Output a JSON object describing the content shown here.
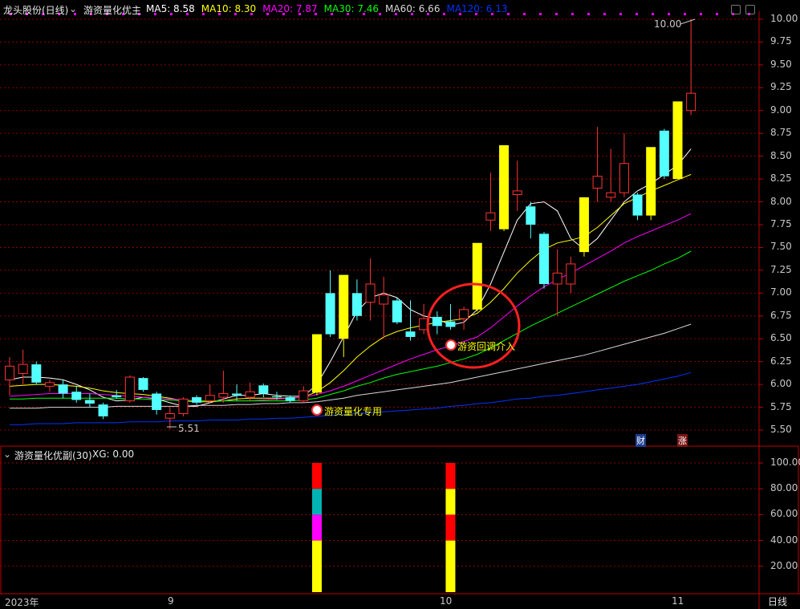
{
  "header": {
    "stock": "龙头股份(日线)",
    "indicator_main": "游资量化优主",
    "ma": [
      {
        "label": "MA5: 8.58",
        "color": "#ffffff"
      },
      {
        "label": "MA10: 8.30",
        "color": "#ffff00"
      },
      {
        "label": "MA20: 7.87",
        "color": "#ff00ff"
      },
      {
        "label": "MA30: 7.46",
        "color": "#00ff00"
      },
      {
        "label": "MA60: 6.66",
        "color": "#d8d8d8"
      },
      {
        "label": "MA120: 6.13",
        "color": "#0033ff"
      }
    ]
  },
  "sub_header": {
    "indicator": "游资量化优副(30)",
    "xg": "XG: 0.00"
  },
  "annotations": {
    "high_value": "10.00",
    "low_value": "5.51",
    "signal_1": "游资量化专用",
    "signal_2": "游资回调介入",
    "badge_cai": "财",
    "badge_zhang": "涨"
  },
  "x_axis": {
    "labels": [
      "2023年",
      "9",
      "10",
      "11"
    ],
    "period": "日线"
  },
  "colors": {
    "up": "#ff3232",
    "down": "#54ffff",
    "signal": "#ffff00",
    "grid": "#8b0000",
    "border": "#c00000"
  },
  "chart_data": [
    {
      "type": "candlestick",
      "title": "",
      "ylim": [
        5.4,
        10.1
      ],
      "y_ticks": [
        "10.00",
        "9.75",
        "9.50",
        "9.25",
        "9.00",
        "8.75",
        "8.50",
        "8.25",
        "8.00",
        "7.75",
        "7.50",
        "7.25",
        "7.00",
        "6.75",
        "6.50",
        "6.25",
        "6.00",
        "5.75",
        "5.50"
      ],
      "candles": [
        {
          "o": 6.05,
          "h": 6.3,
          "l": 5.88,
          "c": 6.2,
          "s": "up"
        },
        {
          "o": 6.12,
          "h": 6.38,
          "l": 6.0,
          "c": 6.22,
          "s": "up"
        },
        {
          "o": 6.22,
          "h": 6.25,
          "l": 6.0,
          "c": 6.02,
          "s": "down"
        },
        {
          "o": 5.98,
          "h": 6.05,
          "l": 5.92,
          "c": 6.02,
          "s": "up"
        },
        {
          "o": 6.0,
          "h": 6.05,
          "l": 5.85,
          "c": 5.9,
          "s": "down"
        },
        {
          "o": 5.92,
          "h": 5.98,
          "l": 5.8,
          "c": 5.83,
          "s": "down"
        },
        {
          "o": 5.83,
          "h": 5.9,
          "l": 5.75,
          "c": 5.79,
          "s": "down"
        },
        {
          "o": 5.78,
          "h": 5.8,
          "l": 5.62,
          "c": 5.65,
          "s": "down"
        },
        {
          "o": 5.88,
          "h": 5.94,
          "l": 5.84,
          "c": 5.86,
          "s": "down"
        },
        {
          "o": 5.82,
          "h": 6.1,
          "l": 5.8,
          "c": 6.08,
          "s": "up"
        },
        {
          "o": 6.07,
          "h": 6.08,
          "l": 5.92,
          "c": 5.94,
          "s": "down"
        },
        {
          "o": 5.9,
          "h": 5.92,
          "l": 5.67,
          "c": 5.72,
          "s": "down"
        },
        {
          "o": 5.63,
          "h": 5.75,
          "l": 5.51,
          "c": 5.68,
          "s": "up"
        },
        {
          "o": 5.68,
          "h": 5.86,
          "l": 5.65,
          "c": 5.84,
          "s": "up"
        },
        {
          "o": 5.86,
          "h": 5.88,
          "l": 5.78,
          "c": 5.8,
          "s": "down"
        },
        {
          "o": 5.82,
          "h": 6.0,
          "l": 5.8,
          "c": 5.88,
          "s": "up"
        },
        {
          "o": 5.86,
          "h": 6.15,
          "l": 5.8,
          "c": 5.9,
          "s": "up"
        },
        {
          "o": 5.88,
          "h": 6.0,
          "l": 5.82,
          "c": 5.9,
          "s": "down"
        },
        {
          "o": 5.86,
          "h": 6.02,
          "l": 5.82,
          "c": 5.92,
          "s": "up"
        },
        {
          "o": 5.99,
          "h": 6.01,
          "l": 5.86,
          "c": 5.9,
          "s": "down"
        },
        {
          "o": 5.86,
          "h": 5.92,
          "l": 5.83,
          "c": 5.87,
          "s": "down"
        },
        {
          "o": 5.86,
          "h": 5.88,
          "l": 5.8,
          "c": 5.82,
          "s": "down"
        },
        {
          "o": 5.82,
          "h": 5.98,
          "l": 5.8,
          "c": 5.93,
          "s": "up"
        },
        {
          "o": 5.91,
          "h": 6.55,
          "l": 5.88,
          "c": 6.55,
          "s": "signal"
        },
        {
          "o": 6.55,
          "h": 7.25,
          "l": 6.52,
          "c": 7.0,
          "s": "down"
        },
        {
          "o": 6.5,
          "h": 7.2,
          "l": 6.3,
          "c": 7.2,
          "s": "signal"
        },
        {
          "o": 7.0,
          "h": 7.15,
          "l": 6.7,
          "c": 6.75,
          "s": "down"
        },
        {
          "o": 6.9,
          "h": 7.38,
          "l": 6.7,
          "c": 7.1,
          "s": "up"
        },
        {
          "o": 6.88,
          "h": 7.18,
          "l": 6.5,
          "c": 6.98,
          "s": "up"
        },
        {
          "o": 6.92,
          "h": 6.95,
          "l": 6.66,
          "c": 6.68,
          "s": "down"
        },
        {
          "o": 6.58,
          "h": 6.92,
          "l": 6.48,
          "c": 6.52,
          "s": "down"
        },
        {
          "o": 6.6,
          "h": 6.88,
          "l": 6.55,
          "c": 6.72,
          "s": "up"
        },
        {
          "o": 6.74,
          "h": 6.8,
          "l": 6.55,
          "c": 6.64,
          "s": "down"
        },
        {
          "o": 6.63,
          "h": 6.88,
          "l": 6.6,
          "c": 6.69,
          "s": "down"
        },
        {
          "o": 6.72,
          "h": 6.85,
          "l": 6.6,
          "c": 6.82,
          "s": "up"
        },
        {
          "o": 6.82,
          "h": 7.55,
          "l": 6.8,
          "c": 7.55,
          "s": "signal"
        },
        {
          "o": 7.8,
          "h": 8.32,
          "l": 7.68,
          "c": 7.88,
          "s": "up"
        },
        {
          "o": 7.7,
          "h": 8.62,
          "l": 7.68,
          "c": 8.62,
          "s": "signal"
        },
        {
          "o": 8.08,
          "h": 8.45,
          "l": 7.9,
          "c": 8.12,
          "s": "up"
        },
        {
          "o": 7.95,
          "h": 8.0,
          "l": 7.6,
          "c": 7.75,
          "s": "down"
        },
        {
          "o": 7.65,
          "h": 7.67,
          "l": 7.05,
          "c": 7.1,
          "s": "down"
        },
        {
          "o": 7.22,
          "h": 7.48,
          "l": 6.75,
          "c": 7.1,
          "s": "up"
        },
        {
          "o": 7.1,
          "h": 7.4,
          "l": 7.0,
          "c": 7.32,
          "s": "up"
        },
        {
          "o": 7.45,
          "h": 8.05,
          "l": 7.4,
          "c": 8.05,
          "s": "signal"
        },
        {
          "o": 8.15,
          "h": 8.82,
          "l": 8.0,
          "c": 8.28,
          "s": "up"
        },
        {
          "o": 8.05,
          "h": 8.58,
          "l": 8.0,
          "c": 8.1,
          "s": "up"
        },
        {
          "o": 8.1,
          "h": 8.75,
          "l": 8.05,
          "c": 8.42,
          "s": "up"
        },
        {
          "o": 8.08,
          "h": 8.1,
          "l": 7.8,
          "c": 7.85,
          "s": "down"
        },
        {
          "o": 7.85,
          "h": 8.6,
          "l": 7.8,
          "c": 8.6,
          "s": "signal"
        },
        {
          "o": 8.78,
          "h": 8.8,
          "l": 8.25,
          "c": 8.28,
          "s": "down"
        },
        {
          "o": 8.25,
          "h": 9.1,
          "l": 8.25,
          "c": 9.1,
          "s": "signal"
        },
        {
          "o": 9.0,
          "h": 10.0,
          "l": 8.95,
          "c": 9.19,
          "s": "up"
        }
      ],
      "series": [
        {
          "name": "MA5",
          "color": "#ffffff",
          "values": [
            6.05,
            6.08,
            6.08,
            6.07,
            6.05,
            6.0,
            5.94,
            5.86,
            5.82,
            5.83,
            5.86,
            5.84,
            5.8,
            5.76,
            5.76,
            5.8,
            5.84,
            5.88,
            5.88,
            5.9,
            5.88,
            5.87,
            5.87,
            6.0,
            6.25,
            6.52,
            6.8,
            6.95,
            7.0,
            6.95,
            6.82,
            6.75,
            6.72,
            6.65,
            6.68,
            6.82,
            7.1,
            7.45,
            7.8,
            7.98,
            8.0,
            7.9,
            7.6,
            7.48,
            7.6,
            7.8,
            8.0,
            8.12,
            8.2,
            8.3,
            8.4,
            8.58
          ]
        },
        {
          "name": "MA10",
          "color": "#ffff00",
          "values": [
            5.98,
            5.99,
            6.0,
            6.0,
            5.99,
            5.98,
            5.96,
            5.93,
            5.91,
            5.9,
            5.89,
            5.87,
            5.85,
            5.82,
            5.81,
            5.81,
            5.82,
            5.84,
            5.85,
            5.85,
            5.85,
            5.85,
            5.86,
            5.92,
            6.02,
            6.15,
            6.3,
            6.42,
            6.52,
            6.58,
            6.62,
            6.65,
            6.68,
            6.7,
            6.72,
            6.78,
            6.9,
            7.05,
            7.22,
            7.36,
            7.48,
            7.55,
            7.58,
            7.62,
            7.72,
            7.85,
            7.98,
            8.05,
            8.12,
            8.18,
            8.24,
            8.3
          ]
        },
        {
          "name": "MA20",
          "color": "#ff00ff",
          "values": [
            5.87,
            5.88,
            5.89,
            5.9,
            5.9,
            5.9,
            5.9,
            5.89,
            5.88,
            5.87,
            5.86,
            5.85,
            5.84,
            5.83,
            5.82,
            5.82,
            5.82,
            5.82,
            5.82,
            5.83,
            5.84,
            5.85,
            5.86,
            5.89,
            5.93,
            5.98,
            6.04,
            6.1,
            6.16,
            6.22,
            6.28,
            6.33,
            6.38,
            6.42,
            6.47,
            6.52,
            6.62,
            6.74,
            6.86,
            6.97,
            7.07,
            7.15,
            7.22,
            7.3,
            7.38,
            7.46,
            7.55,
            7.62,
            7.68,
            7.74,
            7.8,
            7.87
          ]
        },
        {
          "name": "MA30",
          "color": "#00ff00",
          "values": [
            5.84,
            5.84,
            5.85,
            5.85,
            5.85,
            5.85,
            5.85,
            5.85,
            5.85,
            5.84,
            5.84,
            5.83,
            5.83,
            5.82,
            5.82,
            5.82,
            5.82,
            5.82,
            5.82,
            5.82,
            5.82,
            5.82,
            5.83,
            5.85,
            5.89,
            5.93,
            5.98,
            6.02,
            6.07,
            6.11,
            6.14,
            6.17,
            6.2,
            6.24,
            6.28,
            6.33,
            6.4,
            6.48,
            6.56,
            6.64,
            6.71,
            6.78,
            6.85,
            6.92,
            6.99,
            7.06,
            7.13,
            7.19,
            7.25,
            7.32,
            7.38,
            7.46
          ]
        },
        {
          "name": "MA60",
          "color": "#d8d8d8",
          "values": [
            5.74,
            5.74,
            5.74,
            5.75,
            5.75,
            5.75,
            5.75,
            5.75,
            5.76,
            5.76,
            5.76,
            5.76,
            5.76,
            5.76,
            5.77,
            5.77,
            5.77,
            5.78,
            5.78,
            5.79,
            5.79,
            5.8,
            5.8,
            5.81,
            5.83,
            5.85,
            5.88,
            5.9,
            5.92,
            5.94,
            5.96,
            5.98,
            6.0,
            6.02,
            6.05,
            6.08,
            6.11,
            6.14,
            6.17,
            6.2,
            6.23,
            6.26,
            6.29,
            6.32,
            6.36,
            6.4,
            6.44,
            6.48,
            6.52,
            6.56,
            6.61,
            6.66
          ]
        },
        {
          "name": "MA120",
          "color": "#0033ff",
          "values": [
            5.56,
            5.56,
            5.57,
            5.57,
            5.57,
            5.58,
            5.58,
            5.58,
            5.58,
            5.59,
            5.59,
            5.59,
            5.6,
            5.6,
            5.6,
            5.61,
            5.61,
            5.61,
            5.62,
            5.62,
            5.63,
            5.63,
            5.64,
            5.65,
            5.66,
            5.67,
            5.68,
            5.69,
            5.7,
            5.71,
            5.72,
            5.73,
            5.74,
            5.76,
            5.77,
            5.79,
            5.8,
            5.82,
            5.84,
            5.85,
            5.87,
            5.88,
            5.9,
            5.92,
            5.94,
            5.96,
            5.98,
            6.0,
            6.03,
            6.06,
            6.09,
            6.13
          ]
        }
      ]
    },
    {
      "type": "bar",
      "title": "",
      "ylim": [
        0,
        100
      ],
      "y_ticks": [
        "100.00",
        "80.00",
        "60.00",
        "40.00",
        "20.00"
      ],
      "stacks": [
        {
          "index": 23,
          "segments": [
            {
              "from": 0,
              "to": 40,
              "color": "#ffff00"
            },
            {
              "from": 40,
              "to": 60,
              "color": "#ff00ff"
            },
            {
              "from": 60,
              "to": 80,
              "color": "#00b4b4"
            },
            {
              "from": 80,
              "to": 100,
              "color": "#ff0000"
            }
          ]
        },
        {
          "index": 33,
          "segments": [
            {
              "from": 0,
              "to": 40,
              "color": "#ffff00"
            },
            {
              "from": 40,
              "to": 60,
              "color": "#ff0000"
            },
            {
              "from": 60,
              "to": 80,
              "color": "#ffff00"
            },
            {
              "from": 80,
              "to": 100,
              "color": "#ff0000"
            }
          ]
        }
      ]
    }
  ]
}
